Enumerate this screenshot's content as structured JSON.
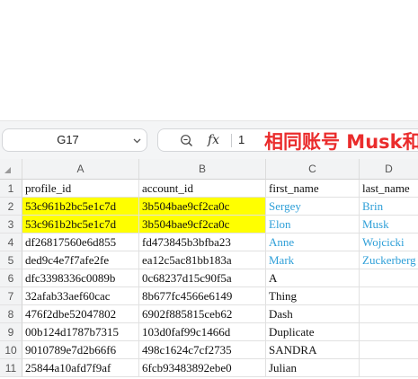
{
  "formula_bar": {
    "name_box": "G17",
    "formula_value": "1",
    "annotation": "相同账号 Musk和"
  },
  "columns": [
    "A",
    "B",
    "C",
    "D"
  ],
  "rows": [
    {
      "num": "1",
      "a": "profile_id",
      "b": "account_id",
      "c": "first_name",
      "d": "last_name",
      "highlight": false,
      "link": false
    },
    {
      "num": "2",
      "a": "53c961b2bc5e1c7d",
      "b": "3b504bae9cf2ca0c",
      "c": "Sergey",
      "d": "Brin",
      "highlight": true,
      "link": true
    },
    {
      "num": "3",
      "a": "53c961b2bc5e1c7d",
      "b": "3b504bae9cf2ca0c",
      "c": "Elon",
      "d": "Musk",
      "highlight": true,
      "link": true
    },
    {
      "num": "4",
      "a": "df26817560e6d855",
      "b": "fd473845b3bfba23",
      "c": "Anne",
      "d": "Wojcicki",
      "highlight": false,
      "link": true
    },
    {
      "num": "5",
      "a": "ded9c4e7f7afe2fe",
      "b": "ea12c5ac81bb183a",
      "c": "Mark",
      "d": "Zuckerberg",
      "highlight": false,
      "link": true
    },
    {
      "num": "6",
      "a": "dfc3398336c0089b",
      "b": "0c68237d15c90f5a",
      "c": "A",
      "d": "",
      "highlight": false,
      "link": false
    },
    {
      "num": "7",
      "a": "32afab33aef60cac",
      "b": "8b677fc4566e6149",
      "c": "Thing",
      "d": "",
      "highlight": false,
      "link": false
    },
    {
      "num": "8",
      "a": "476f2dbe52047802",
      "b": "6902f885815ceb62",
      "c": "Dash",
      "d": "",
      "highlight": false,
      "link": false
    },
    {
      "num": "9",
      "a": "00b124d1787b7315",
      "b": "103d0faf99c1466d",
      "c": "Duplicate",
      "d": "",
      "highlight": false,
      "link": false
    },
    {
      "num": "10",
      "a": "9010789e7d2b66f6",
      "b": "498c1624c7cf2735",
      "c": "SANDRA",
      "d": "",
      "highlight": false,
      "link": false
    },
    {
      "num": "11",
      "a": "25844a10afd7f9af",
      "b": "6fcb93483892ebe0",
      "c": "Julian",
      "d": "",
      "highlight": false,
      "link": false
    }
  ],
  "colors": {
    "highlight": "#ffff00",
    "link_text": "#2e9fd8",
    "annotation": "#ea2c2c"
  }
}
